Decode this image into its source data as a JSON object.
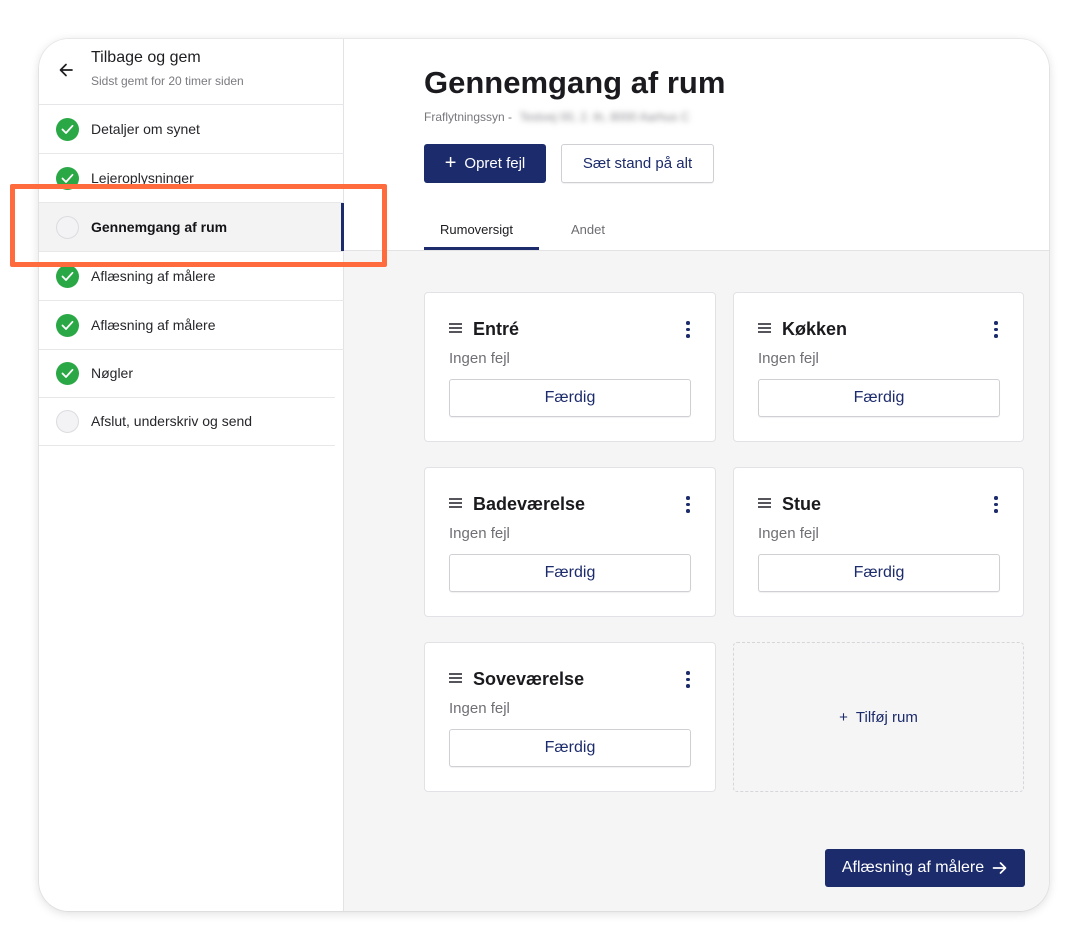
{
  "sidebar": {
    "back_title": "Tilbage og gem",
    "back_subtitle": "Sidst gemt for 20 timer siden",
    "items": [
      {
        "label": "Detaljer om synet",
        "status": "done"
      },
      {
        "label": "Lejeroplysninger",
        "status": "done"
      },
      {
        "label": "Gennemgang af rum",
        "status": "current"
      },
      {
        "label": "Aflæsning af målere",
        "status": "done"
      },
      {
        "label": "Aflæsning af målere",
        "status": "done"
      },
      {
        "label": "Nøgler",
        "status": "done"
      },
      {
        "label": "Afslut, underskriv og send",
        "status": "todo"
      }
    ]
  },
  "main": {
    "title": "Gennemgang af rum",
    "subtitle_prefix": "Fraflytningssyn -",
    "subtitle_address": "Testvej 00, 2. th, 8000 Aarhus C",
    "primary_button": "Opret fejl",
    "secondary_button": "Sæt stand på alt",
    "tabs": [
      {
        "label": "Rumoversigt",
        "active": true
      },
      {
        "label": "Andet",
        "active": false
      }
    ],
    "rooms": [
      {
        "name": "Entré",
        "status": "Ingen fejl",
        "button": "Færdig"
      },
      {
        "name": "Køkken",
        "status": "Ingen fejl",
        "button": "Færdig"
      },
      {
        "name": "Badeværelse",
        "status": "Ingen fejl",
        "button": "Færdig"
      },
      {
        "name": "Stue",
        "status": "Ingen fejl",
        "button": "Færdig"
      },
      {
        "name": "Soveværelse",
        "status": "Ingen fejl",
        "button": "Færdig"
      }
    ],
    "add_room": "Tilføj rum",
    "next_button": "Aflæsning af målere"
  },
  "colors": {
    "brand": "#1c2b6b",
    "success": "#2aa846",
    "highlight": "#ff6b3d"
  }
}
